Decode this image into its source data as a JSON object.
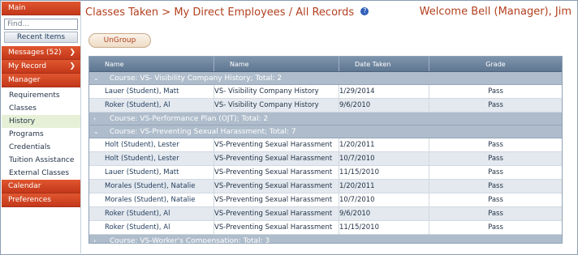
{
  "sidebar": {
    "main_label": "Main",
    "find_placeholder": "Find...",
    "recent_items": "Recent Items",
    "messages": "Messages (52)",
    "my_record": "My Record",
    "manager": "Manager",
    "manager_items": [
      "Requirements",
      "Classes",
      "History",
      "Programs",
      "Credentials",
      "Tuition Assistance",
      "External Classes"
    ],
    "calendar": "Calendar",
    "preferences": "Preferences"
  },
  "header": {
    "breadcrumb": "Classes Taken > My Direct Employees / All Records",
    "help_glyph": "?",
    "welcome": "Welcome Bell (Manager), Jim"
  },
  "toolbar": {
    "ungroup": "UnGroup"
  },
  "grid": {
    "columns": [
      "Name",
      "Name",
      "Date Taken",
      "Grade"
    ],
    "groups": [
      {
        "label": "Course: VS- Visibility Company History; Total: 2",
        "expanded": true,
        "rows": [
          [
            "Lauer (Student), Matt",
            "VS- Visibility Company History",
            "1/29/2014",
            "Pass"
          ],
          [
            "Roker (Student), Al",
            "VS- Visibility Company History",
            "9/6/2010",
            "Pass"
          ]
        ]
      },
      {
        "label": "Course: VS-Performance Plan (OJT); Total: 2",
        "expanded": false,
        "rows": []
      },
      {
        "label": "Course: VS-Preventing Sexual Harassment; Total: 7",
        "expanded": true,
        "rows": [
          [
            "Holt (Student), Lester",
            "VS-Preventing Sexual Harassment",
            "1/20/2011",
            "Pass"
          ],
          [
            "Holt (Student), Lester",
            "VS-Preventing Sexual Harassment",
            "10/7/2010",
            "Pass"
          ],
          [
            "Lauer (Student), Matt",
            "VS-Preventing Sexual Harassment",
            "11/15/2010",
            "Pass"
          ],
          [
            "Morales (Student), Natalie",
            "VS-Preventing Sexual Harassment",
            "1/20/2011",
            "Pass"
          ],
          [
            "Morales (Student), Natalie",
            "VS-Preventing Sexual Harassment",
            "10/7/2010",
            "Pass"
          ],
          [
            "Roker (Student), Al",
            "VS-Preventing Sexual Harassment",
            "9/6/2010",
            "Pass"
          ],
          [
            "Roker (Student), Al",
            "VS-Preventing Sexual Harassment",
            "11/15/2010",
            "Pass"
          ]
        ]
      },
      {
        "label": "Course: VS-Worker's Compensation; Total: 3",
        "expanded": false,
        "rows": []
      }
    ]
  },
  "colors": {
    "accent": "#c3381a",
    "header_text": "#b2401f",
    "grid_header": "#6f86a0",
    "group_row": "#aebccb"
  }
}
